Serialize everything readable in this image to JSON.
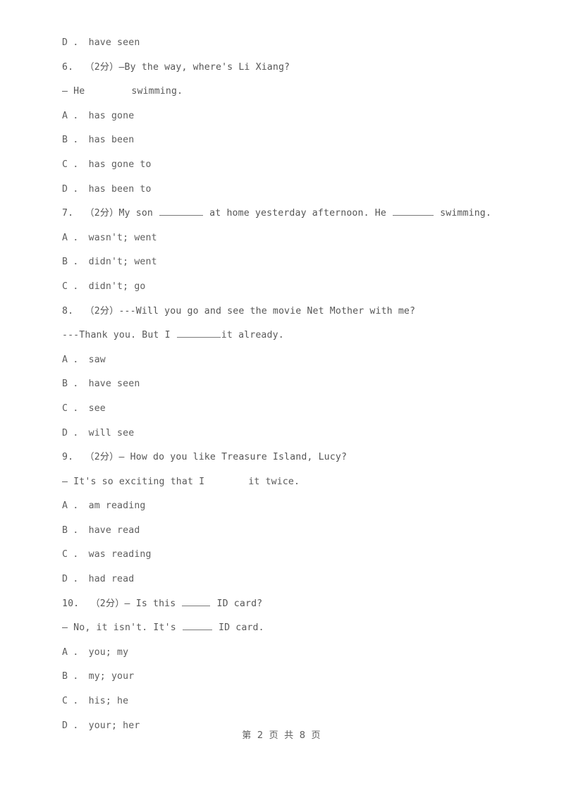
{
  "document": {
    "type": "english-exam-multiple-choice",
    "page_label": "第 2 页 共 8 页",
    "text_color": "#5b5b5b",
    "background_color": "#ffffff"
  },
  "lines": [
    {
      "id": "l1",
      "kind": "option",
      "text": "D ． have seen"
    },
    {
      "id": "l2",
      "kind": "stem",
      "number": "6.",
      "score": "（2分）",
      "text": "6.  （2分）—By the way, where's Li Xiang?"
    },
    {
      "id": "l3",
      "kind": "reply",
      "text": "— He"
    },
    {
      "id": "l3b",
      "kind": "reply",
      "text": "swimming."
    },
    {
      "id": "l4",
      "kind": "option",
      "text": "A ． has gone"
    },
    {
      "id": "l5",
      "kind": "option",
      "text": "B ． has been"
    },
    {
      "id": "l6",
      "kind": "option",
      "text": "C ． has gone to"
    },
    {
      "id": "l7",
      "kind": "option",
      "text": "D ． has been to"
    },
    {
      "id": "l8",
      "kind": "stem",
      "number": "7.",
      "score": "（2分）",
      "text_before": "7.  （2分）My son ",
      "text_middle": " at home yesterday afternoon. He ",
      "text_after": " swimming."
    },
    {
      "id": "l9",
      "kind": "option",
      "text": "A ． wasn't; went"
    },
    {
      "id": "l10",
      "kind": "option",
      "text": "B ． didn't; went"
    },
    {
      "id": "l11",
      "kind": "option",
      "text": "C ． didn't; go"
    },
    {
      "id": "l12",
      "kind": "stem",
      "number": "8.",
      "score": "（2分）",
      "text": "8.  （2分）---Will you go and see the movie Net Mother with me?"
    },
    {
      "id": "l13",
      "kind": "reply",
      "text_before": "---Thank you. But I ",
      "text_after": "it already."
    },
    {
      "id": "l14",
      "kind": "option",
      "text": "A ． saw"
    },
    {
      "id": "l15",
      "kind": "option",
      "text": "B ． have seen"
    },
    {
      "id": "l16",
      "kind": "option",
      "text": "C ． see"
    },
    {
      "id": "l17",
      "kind": "option",
      "text": "D ． will see"
    },
    {
      "id": "l18",
      "kind": "stem",
      "number": "9.",
      "score": "（2分）",
      "text": "9.  （2分）— How do you like Treasure Island, Lucy?"
    },
    {
      "id": "l19",
      "kind": "reply",
      "text_before": "— It's so exciting that I",
      "text_after": "it twice."
    },
    {
      "id": "l20",
      "kind": "option",
      "text": "A ． am reading"
    },
    {
      "id": "l21",
      "kind": "option",
      "text": "B ． have read"
    },
    {
      "id": "l22",
      "kind": "option",
      "text": "C ． was reading"
    },
    {
      "id": "l23",
      "kind": "option",
      "text": "D ． had read"
    },
    {
      "id": "l24",
      "kind": "stem",
      "number": "10.",
      "score": "（2分）",
      "text_before": "10.  （2分）— Is this ",
      "text_after": " ID card?"
    },
    {
      "id": "l25",
      "kind": "reply",
      "text_before": "— No, it isn't. It's ",
      "text_after": " ID card."
    },
    {
      "id": "l26",
      "kind": "option",
      "text": "A ． you; my"
    },
    {
      "id": "l27",
      "kind": "option",
      "text": "B ． my; your"
    },
    {
      "id": "l28",
      "kind": "option",
      "text": "C ． his; he"
    },
    {
      "id": "l29",
      "kind": "option",
      "text": "D ． your; her"
    }
  ],
  "questions": [
    {
      "number": "6",
      "score": "（2分）",
      "stem": "—By the way, where's Li Xiang?",
      "reply": "— He            swimming.",
      "options": [
        "A ． has gone",
        "B ． has been",
        "C ． has gone to",
        "D ． has been to"
      ]
    },
    {
      "number": "7",
      "score": "（2分）",
      "stem": "My son ________ at home yesterday afternoon. He ________ swimming.",
      "options": [
        "A ． wasn't; went",
        "B ． didn't; went",
        "C ． didn't; go"
      ]
    },
    {
      "number": "8",
      "score": "（2分）",
      "stem": "---Will you go and see the movie Net Mother with me?",
      "reply": "---Thank you. But I _________it already.",
      "options": [
        "A ． saw",
        "B ． have seen",
        "C ． see",
        "D ． will see"
      ]
    },
    {
      "number": "9",
      "score": "（2分）",
      "stem": "— How do you like Treasure Island, Lucy?",
      "reply": "— It's so exciting that I          it twice.",
      "options": [
        "A ． am reading",
        "B ． have read",
        "C ． was reading",
        "D ． had read"
      ]
    },
    {
      "number": "10",
      "score": "（2分）",
      "stem": "— Is this _____ ID card?",
      "reply": "— No, it isn't. It's ______ ID card.",
      "options": [
        "A ． you; my",
        "B ． my; your",
        "C ． his; he",
        "D ． your; her"
      ]
    }
  ],
  "previous_question_tail": {
    "option_d": "D ． have seen"
  },
  "footer": {
    "page_text": "第 2 页 共 8 页"
  }
}
